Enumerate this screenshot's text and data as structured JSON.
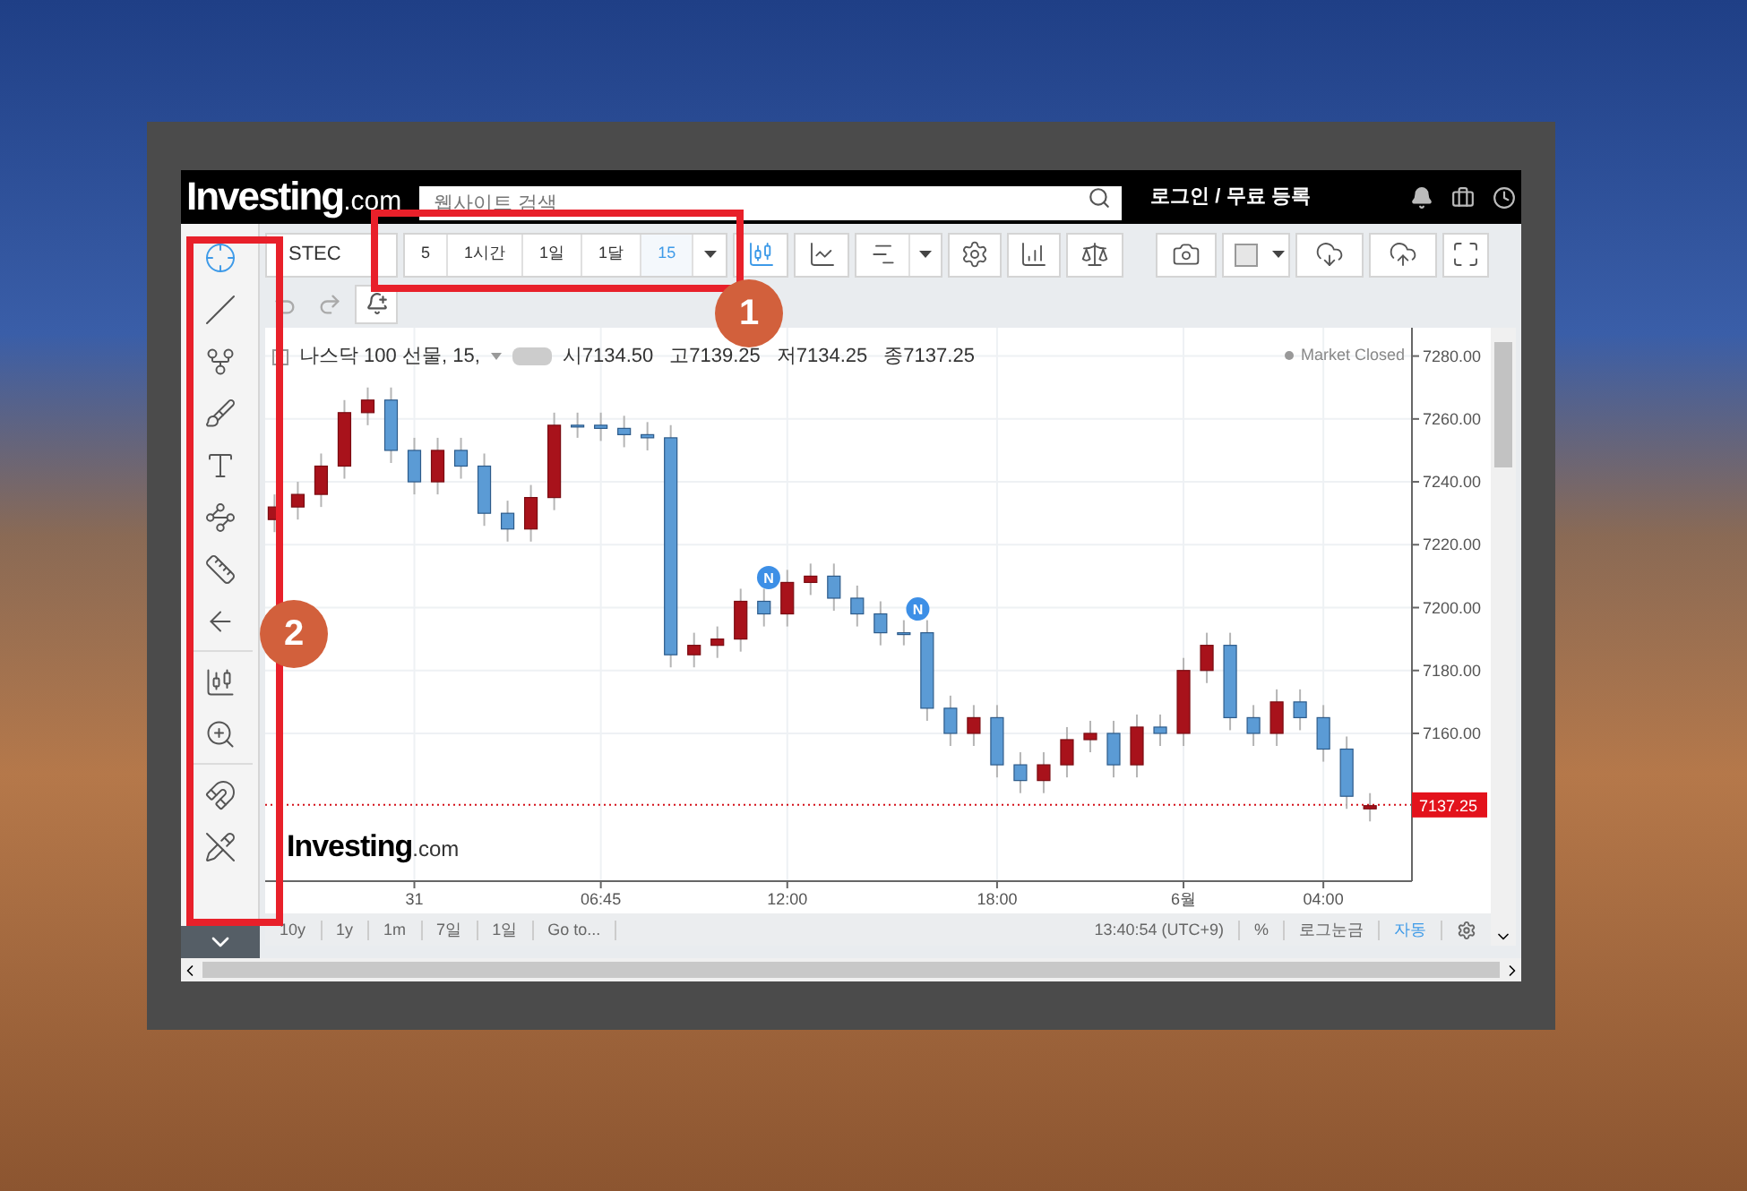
{
  "header": {
    "logo": "Investing",
    "logo_suffix": ".com",
    "search": {
      "placeholder": "웹사이트 검색"
    },
    "login": "로그인 / 무료 등록"
  },
  "left_tools": [
    {
      "kind": "crosshair",
      "selected": true
    },
    {
      "kind": "line",
      "selected": false
    },
    {
      "kind": "fork",
      "selected": false
    },
    {
      "kind": "brush",
      "selected": false
    },
    {
      "kind": "text",
      "selected": false
    },
    {
      "kind": "nodes",
      "selected": false
    },
    {
      "kind": "ruler",
      "selected": false
    },
    {
      "kind": "arrow",
      "selected": false
    },
    {
      "kind": "divider"
    },
    {
      "kind": "measure",
      "selected": false
    },
    {
      "kind": "zoom",
      "selected": false
    },
    {
      "kind": "divider"
    },
    {
      "kind": "magnet",
      "selected": false
    },
    {
      "kind": "lock",
      "selected": false
    }
  ],
  "toolbar": {
    "symbol": "STEC",
    "intervals": [
      {
        "label": "5",
        "selected": false
      },
      {
        "label": "1시간",
        "selected": false
      },
      {
        "label": "1일",
        "selected": false
      },
      {
        "label": "1달",
        "selected": false
      },
      {
        "label": "15",
        "selected": true
      }
    ],
    "chart_types": [
      {
        "kind": "candles",
        "selected": true
      },
      {
        "kind": "line",
        "selected": false
      },
      {
        "kind": "bars",
        "selected": false
      }
    ],
    "tools": [
      {
        "kind": "settings"
      },
      {
        "kind": "indicators"
      },
      {
        "kind": "scale"
      },
      {
        "kind": "gap"
      },
      {
        "kind": "camera"
      },
      {
        "kind": "color"
      },
      {
        "kind": "cloud-down"
      },
      {
        "kind": "cloud-up"
      },
      {
        "kind": "fullscreen"
      }
    ]
  },
  "legend": {
    "title": "나스닥 100 선물, 15,",
    "values": [
      {
        "label": "시",
        "value": "7134.50"
      },
      {
        "label": "고",
        "value": "7139.25"
      },
      {
        "label": "저",
        "value": "7134.25"
      },
      {
        "label": "종",
        "value": "7137.25"
      }
    ],
    "status": "Market Closed"
  },
  "chart": {
    "logo": "Investing",
    "logo_suffix": ".com",
    "last_price": "7137.25",
    "chart_data": {
      "type": "candlestick",
      "categories": [
        null,
        null,
        null,
        null,
        null,
        null,
        "31",
        null,
        null,
        null,
        null,
        null,
        null,
        null,
        "06:45",
        null,
        null,
        null,
        null,
        null,
        null,
        null,
        "12:00",
        null,
        null,
        null,
        null,
        null,
        null,
        null,
        null,
        "18:00",
        null,
        null,
        null,
        null,
        null,
        null,
        null,
        "6월",
        null,
        null,
        null,
        null,
        null,
        "04:00",
        null,
        null
      ],
      "ohlc": [
        [
          7228,
          7236,
          7224,
          7232
        ],
        [
          7232,
          7240,
          7228,
          7236
        ],
        [
          7236,
          7249,
          7232,
          7245
        ],
        [
          7245,
          7266,
          7241,
          7262
        ],
        [
          7262,
          7270,
          7258,
          7266
        ],
        [
          7266,
          7270,
          7246,
          7250
        ],
        [
          7250,
          7254,
          7236,
          7240
        ],
        [
          7240,
          7254,
          7236,
          7250
        ],
        [
          7250,
          7254,
          7241,
          7245
        ],
        [
          7245,
          7249,
          7226,
          7230
        ],
        [
          7230,
          7234,
          7221,
          7225
        ],
        [
          7225,
          7239,
          7221,
          7235
        ],
        [
          7235,
          7262,
          7231,
          7258
        ],
        [
          7258,
          7262,
          7254,
          7258
        ],
        [
          7258,
          7262,
          7253,
          7257
        ],
        [
          7257,
          7261,
          7251,
          7255
        ],
        [
          7255,
          7259,
          7250,
          7254
        ],
        [
          7254,
          7258,
          7181,
          7185
        ],
        [
          7185,
          7192,
          7181,
          7188
        ],
        [
          7188,
          7194,
          7184,
          7190
        ],
        [
          7190,
          7206,
          7186,
          7202
        ],
        [
          7202,
          7206,
          7194,
          7198
        ],
        [
          7198,
          7212,
          7194,
          7208
        ],
        [
          7208,
          7214,
          7204,
          7210
        ],
        [
          7210,
          7214,
          7199,
          7203
        ],
        [
          7203,
          7207,
          7194,
          7198
        ],
        [
          7198,
          7202,
          7188,
          7192
        ],
        [
          7192,
          7196,
          7188,
          7192
        ],
        [
          7192,
          7196,
          7164,
          7168
        ],
        [
          7168,
          7172,
          7156,
          7160
        ],
        [
          7160,
          7169,
          7156,
          7165
        ],
        [
          7165,
          7169,
          7146,
          7150
        ],
        [
          7150,
          7154,
          7141,
          7145
        ],
        [
          7145,
          7154,
          7141,
          7150
        ],
        [
          7150,
          7162,
          7146,
          7158
        ],
        [
          7158,
          7164,
          7154,
          7160
        ],
        [
          7160,
          7164,
          7146,
          7150
        ],
        [
          7150,
          7166,
          7146,
          7162
        ],
        [
          7162,
          7166,
          7156,
          7160
        ],
        [
          7160,
          7184,
          7156,
          7180
        ],
        [
          7180,
          7192,
          7176,
          7188
        ],
        [
          7188,
          7192,
          7161,
          7165
        ],
        [
          7165,
          7169,
          7156,
          7160
        ],
        [
          7160,
          7174,
          7156,
          7170
        ],
        [
          7170,
          7174,
          7161,
          7165
        ],
        [
          7165,
          7169,
          7151,
          7155
        ],
        [
          7155,
          7159,
          7136,
          7140
        ],
        [
          7136,
          7141,
          7132,
          7137
        ]
      ],
      "ylim": [
        7113,
        7289
      ],
      "grid": true,
      "ref_lines": [
        {
          "axis": "y",
          "value": 7137.25
        }
      ],
      "yticks": [
        {
          "value": 7280,
          "label": "7280.00"
        },
        {
          "value": 7260,
          "label": "7260.00"
        },
        {
          "value": 7240,
          "label": "7240.00"
        },
        {
          "value": 7220,
          "label": "7220.00"
        },
        {
          "value": 7200,
          "label": "7200.00"
        },
        {
          "value": 7180,
          "label": "7180.00"
        },
        {
          "value": 7160,
          "label": "7160.00"
        }
      ],
      "annotations": [
        "N",
        "N"
      ]
    }
  },
  "bottom_bar": {
    "ranges": [
      "10y",
      "1y",
      "1m",
      "7일",
      "1일",
      "Go to..."
    ],
    "time": "13:40:54 (UTC+9)",
    "options": [
      {
        "label": "%",
        "selected": false
      },
      {
        "label": "로그눈금",
        "selected": false
      },
      {
        "label": "자동",
        "selected": true
      }
    ]
  },
  "callouts": [
    {
      "label": "1"
    },
    {
      "label": "2"
    }
  ]
}
